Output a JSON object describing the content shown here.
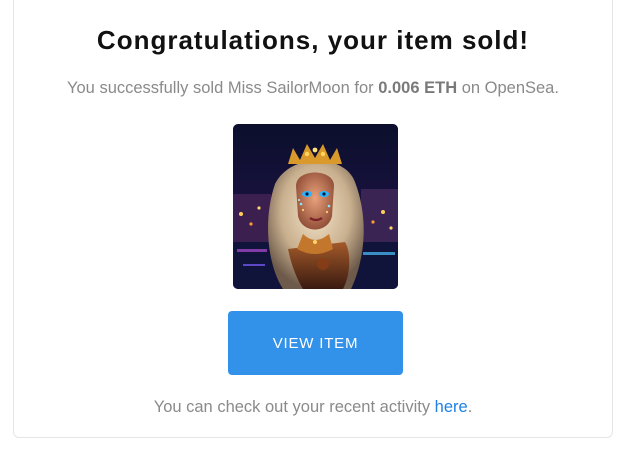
{
  "email": {
    "title": "Congratulations, your item sold!",
    "message": {
      "prefix": "You successfully sold ",
      "item_name": "Miss SailorMoon",
      "for_text": " for ",
      "price": "0.006 ETH",
      "on_text": " on ",
      "marketplace": "OpenSea",
      "suffix": "."
    },
    "image_alt": "Miss SailorMoon",
    "button_label": "VIEW ITEM",
    "footer": {
      "text": "You can check out your recent activity ",
      "link_text": "here",
      "suffix": "."
    }
  },
  "colors": {
    "button": "#3291e8",
    "link": "#2081e2",
    "muted_text": "#8a8a8a"
  }
}
